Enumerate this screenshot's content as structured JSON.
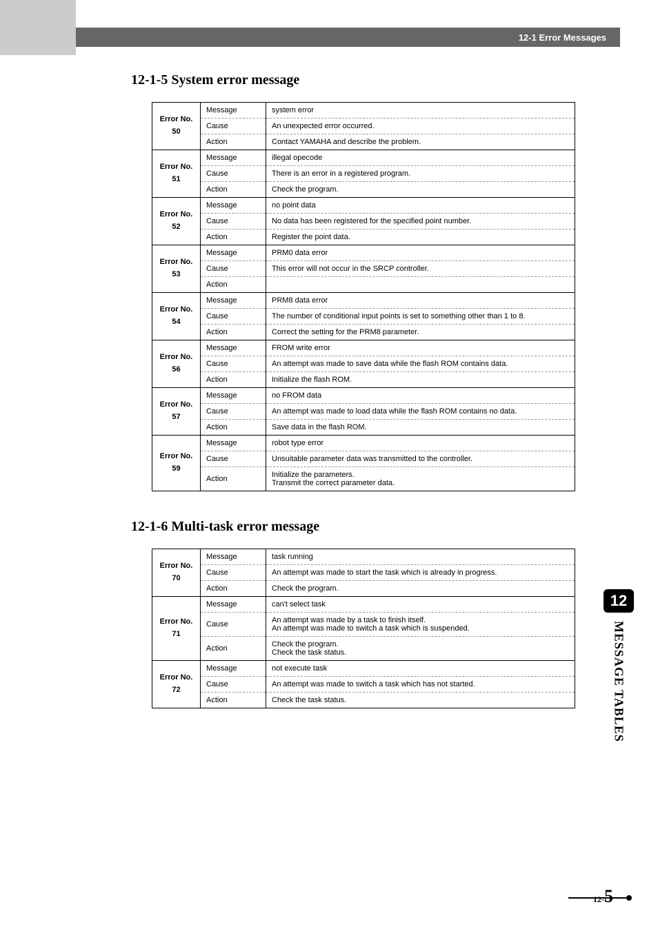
{
  "header": {
    "breadcrumb": "12-1 Error Messages"
  },
  "sections": [
    {
      "title": "12-1-5 System error message",
      "errors": [
        {
          "no": "50",
          "rows": [
            {
              "label": "Message",
              "desc": "system error"
            },
            {
              "label": "Cause",
              "desc": "An unexpected error occurred."
            },
            {
              "label": "Action",
              "desc": "Contact YAMAHA and describe the problem."
            }
          ]
        },
        {
          "no": "51",
          "rows": [
            {
              "label": "Message",
              "desc": "illegal opecode"
            },
            {
              "label": "Cause",
              "desc": "There is an error in a registered program."
            },
            {
              "label": "Action",
              "desc": "Check the program."
            }
          ]
        },
        {
          "no": "52",
          "rows": [
            {
              "label": "Message",
              "desc": "no point data"
            },
            {
              "label": "Cause",
              "desc": "No data has been registered for the specified point number."
            },
            {
              "label": "Action",
              "desc": "Register the point data."
            }
          ]
        },
        {
          "no": "53",
          "rows": [
            {
              "label": "Message",
              "desc": "PRM0 data error"
            },
            {
              "label": "Cause",
              "desc": "This error will not occur in the SRCP controller."
            },
            {
              "label": "Action",
              "desc": ""
            }
          ]
        },
        {
          "no": "54",
          "rows": [
            {
              "label": "Message",
              "desc": "PRM8 data error"
            },
            {
              "label": "Cause",
              "desc": "The number of conditional input points is set to something other than 1 to 8."
            },
            {
              "label": "Action",
              "desc": "Correct the setting for the PRM8 parameter."
            }
          ]
        },
        {
          "no": "56",
          "rows": [
            {
              "label": "Message",
              "desc": "FROM write error"
            },
            {
              "label": "Cause",
              "desc": "An attempt was made to save data while the flash ROM contains data."
            },
            {
              "label": "Action",
              "desc": "Initialize the flash ROM."
            }
          ]
        },
        {
          "no": "57",
          "rows": [
            {
              "label": "Message",
              "desc": "no FROM data"
            },
            {
              "label": "Cause",
              "desc": "An attempt was made to load data while the flash ROM contains no data."
            },
            {
              "label": "Action",
              "desc": "Save data in the flash ROM."
            }
          ]
        },
        {
          "no": "59",
          "rows": [
            {
              "label": "Message",
              "desc": "robot type error"
            },
            {
              "label": "Cause",
              "desc": "Unsuitable parameter data was transmitted to the controller."
            },
            {
              "label": "Action",
              "desc": "Initialize the parameters.\nTransmit the correct parameter data."
            }
          ]
        }
      ]
    },
    {
      "title": "12-1-6 Multi-task error message",
      "errors": [
        {
          "no": "70",
          "rows": [
            {
              "label": "Message",
              "desc": "task running"
            },
            {
              "label": "Cause",
              "desc": "An attempt was made to start the task which is already in progress."
            },
            {
              "label": "Action",
              "desc": "Check the program."
            }
          ]
        },
        {
          "no": "71",
          "rows": [
            {
              "label": "Message",
              "desc": "can't select task"
            },
            {
              "label": "Cause",
              "desc": "An attempt was made by a task to finish itself.\nAn attempt was made to switch a task which is suspended."
            },
            {
              "label": "Action",
              "desc": "Check the program.\nCheck the task status."
            }
          ]
        },
        {
          "no": "72",
          "rows": [
            {
              "label": "Message",
              "desc": "not execute task"
            },
            {
              "label": "Cause",
              "desc": "An attempt was made to switch a task which has not started."
            },
            {
              "label": "Action",
              "desc": "Check the task status."
            }
          ]
        }
      ]
    }
  ],
  "sideTab": {
    "chapter": "12",
    "label": "MESSAGE TABLES"
  },
  "page": {
    "prefix": "12-",
    "num": "5"
  },
  "rowLabels": {
    "errno": "Error No."
  }
}
